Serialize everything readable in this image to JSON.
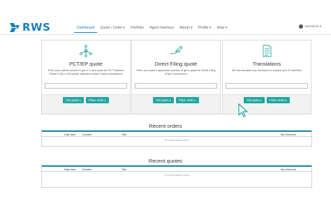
{
  "brand": {
    "name": "RWS",
    "color": "#1a7fbd"
  },
  "nav": {
    "items": [
      {
        "label": "Dashboard",
        "active": true
      },
      {
        "label": "Quote / Order ▾",
        "active": false
      },
      {
        "label": "Portfolio",
        "active": false
      },
      {
        "label": "Agent interface",
        "active": false
      },
      {
        "label": "Admin ▾",
        "active": false
      },
      {
        "label": "Profile ▾",
        "active": false
      },
      {
        "label": "Help ▾",
        "active": false
      }
    ]
  },
  "user": {
    "name": "username ▾",
    "icon": "user-icon"
  },
  "cards": [
    {
      "icon": "network-nodes-icon",
      "title": "PCT/EP quote",
      "description": "Enter your patent number to get a 1-click quote for PCT National Phase Entry or European Validation and/or Claims translations",
      "input_value": "",
      "get_quote": "Get quote ▸",
      "place_order": "Place order ▸"
    },
    {
      "icon": "pen-signature-icon",
      "title": "Direct Filing quote",
      "description": "Enter your patent application number to get a quote for Direct Filing (Paris Convention)",
      "input_value": "",
      "get_quote": "Get quote ▸",
      "place_order": "Place order ▸"
    },
    {
      "icon": "document-icon",
      "title": "Translations",
      "description": "We can translate any document to support your IP activities",
      "input_value": "",
      "get_quote": "Get quote ▸",
      "place_order": "Place order ▸"
    }
  ],
  "accent": "#23a6a0",
  "orders": {
    "title": "Recent orders",
    "columns": [
      "Date date",
      "Number",
      "Title",
      "My reference"
    ],
    "empty": "No recent orders found"
  },
  "quotes": {
    "title": "Recent quotes",
    "columns": [
      "Date date",
      "Number",
      "Title",
      "My reference"
    ],
    "empty": "No recent quotes found"
  }
}
